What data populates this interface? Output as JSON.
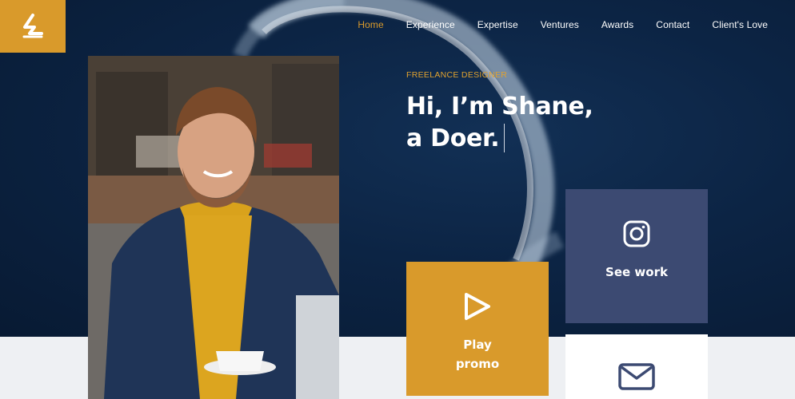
{
  "nav": {
    "items": [
      {
        "label": "Home",
        "active": true
      },
      {
        "label": "Experience",
        "active": false
      },
      {
        "label": "Expertise",
        "active": false
      },
      {
        "label": "Ventures",
        "active": false
      },
      {
        "label": "Awards",
        "active": false
      },
      {
        "label": "Contact",
        "active": false
      },
      {
        "label": "Client's Love",
        "active": false
      }
    ]
  },
  "hero": {
    "kicker": "FREELANCE DESIGNER",
    "headline_line1": "Hi, I’m Shane,",
    "headline_line2": "a  Doer."
  },
  "cards": {
    "see_work": {
      "label": "See work",
      "icon": "instagram-icon"
    },
    "play_promo": {
      "label": "Play promo",
      "icon": "play-icon"
    },
    "mail": {
      "icon": "mail-icon"
    }
  },
  "colors": {
    "accent": "#d99a2b",
    "navy": "#0c2444",
    "card_slate": "#3c4a72"
  }
}
